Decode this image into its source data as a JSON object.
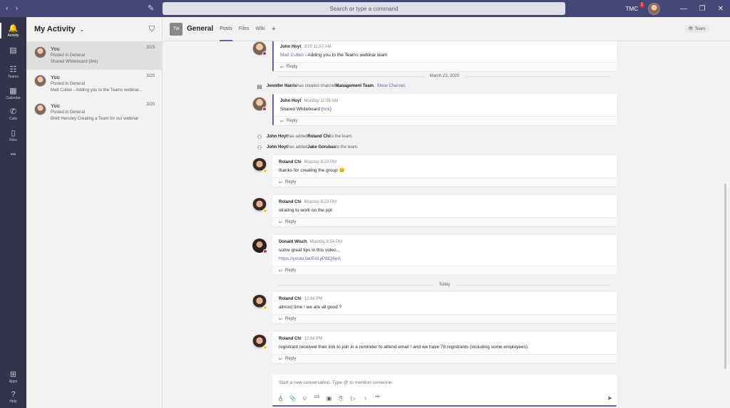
{
  "titlebar": {
    "back": "‹",
    "forward": "›",
    "compose_icon": "✎",
    "search_placeholder": "Search or type a command",
    "user_initials": "TMC",
    "notification_count": "1",
    "minimize": "—",
    "maximize": "❐",
    "close": "✕"
  },
  "rail": {
    "items": [
      {
        "label": "Activity",
        "icon": "🔔"
      },
      {
        "label": "",
        "icon": "▤"
      },
      {
        "label": "Teams",
        "icon": "☷"
      },
      {
        "label": "Calendar",
        "icon": "▦"
      },
      {
        "label": "Calls",
        "icon": "✆"
      },
      {
        "label": "Files",
        "icon": "▯"
      },
      {
        "label": "",
        "icon": "•••"
      },
      {
        "label": "Apps",
        "icon": "⊞"
      },
      {
        "label": "Help",
        "icon": "?"
      }
    ]
  },
  "activity": {
    "title": "My Activity",
    "chevron": "⌄",
    "filter_icon": "⛉",
    "items": [
      {
        "name": "You",
        "location": "Posted in General",
        "preview": "Shared Whiteboard (link)",
        "date": "3/23"
      },
      {
        "name": "You",
        "location": "Posted in General",
        "preview": "Matt Cullen - Adding you to the Teams webinar...",
        "date": "3/20"
      },
      {
        "name": "You",
        "location": "Posted in General",
        "preview": "Brett Hensley Creating a Team for our webinar",
        "date": "3/20"
      }
    ]
  },
  "channel": {
    "tile": "TW",
    "name": "General",
    "tabs": [
      "Posts",
      "Files",
      "Wiki"
    ],
    "add": "+",
    "team_button": "👁 Team"
  },
  "feed": {
    "reply_label": "Reply",
    "reply_icon": "↩",
    "posts": [
      {
        "author": "John Hoyt",
        "time": "3/20 11:57 AM",
        "text_link": "Matt Cullen",
        "text": " - Adding you to the Teams webinar team"
      },
      {
        "author": "John Hoyt",
        "time": "Monday 11:56 AM",
        "text": "Shared Whiteboard (",
        "text_link": "link",
        "text_after": ")"
      },
      {
        "author": "Roland Chi",
        "time": "Monday 6:23 PM",
        "text": "thanks for creating the group ",
        "emoji": "😊"
      },
      {
        "author": "Roland Chi",
        "time": "Monday 6:23 PM",
        "text": "strating to work on the ppt"
      },
      {
        "author": "Donald Wisch",
        "time": "Monday 8:54 PM",
        "text": "some great tips in this video...",
        "link": "https://youtu.be/PoLyP8lQ6eA"
      },
      {
        "author": "Roland Chi",
        "time": "12:54 PM",
        "text": "almost time ! we are all good ?"
      },
      {
        "author": "Roland Chi",
        "time": "12:54 PM",
        "text": "registrant received their link to join in a reminder to attend email ! and we have  78 registrants (including some employees)"
      }
    ],
    "dividers": [
      "March 23, 2020",
      "Today"
    ],
    "system": [
      {
        "icon": "▤",
        "actor": "Jennifer Harris",
        "middle": " has created channel ",
        "target": "Management Team",
        "end": ".",
        "link": "Show Channel."
      },
      {
        "icon": "⚇",
        "actor": "John Hoyt",
        "middle": " has added ",
        "target": "Roland Chi",
        "end": " to the team."
      },
      {
        "icon": "⚇",
        "actor": "John Hoyt",
        "middle": " has added ",
        "target": "Jake Gorubas",
        "end": " to the team."
      }
    ]
  },
  "compose": {
    "placeholder": "Start a new conversation. Type @ to mention someone.",
    "tools": [
      "A̲",
      "📎",
      "☺",
      "GIF",
      "▣",
      "⎘",
      "▷",
      "♀",
      "•••"
    ],
    "send_icon": "➤"
  },
  "colors": {
    "titlebar": "#464775",
    "rail": "#33344a",
    "accent": "#6264a7",
    "busy": "#c4314b",
    "away": "#f8d22a"
  }
}
